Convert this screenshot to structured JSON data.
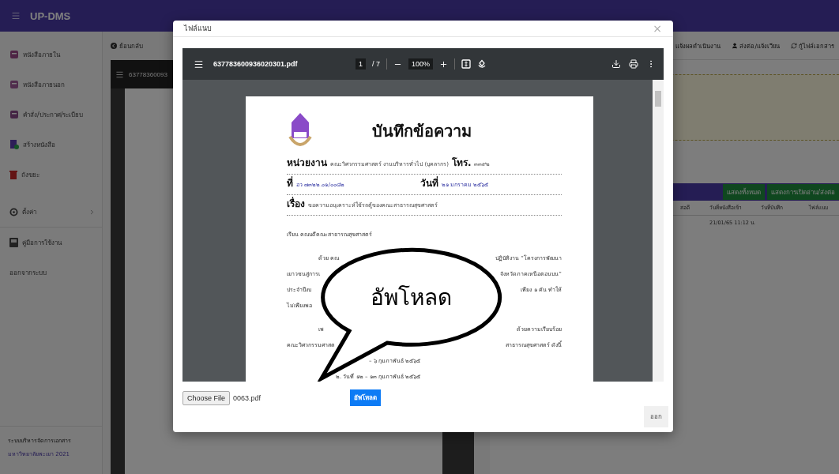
{
  "app": {
    "title": "UP-DMS"
  },
  "sidebar": {
    "items": [
      {
        "label": "หนังสือภายใน"
      },
      {
        "label": "หนังสือภายนอก"
      },
      {
        "label": "คำสั่ง/ประกาศ/ระเบียบ"
      },
      {
        "label": "สร้างหนังสือ"
      },
      {
        "label": "ถังขยะ"
      },
      {
        "label": "ตั้งค่า",
        "expanded": false
      },
      {
        "label": "คู่มือการใช้งาน"
      },
      {
        "label": "ออกจากระบบ"
      }
    ],
    "footer": {
      "line_1": "ระบบบริหารจัดการเอกสาร",
      "line_2": "มหาวิทยาลัยพะเยา 2021"
    }
  },
  "main": {
    "back_link": "ย้อนกลับ",
    "viewer_filename": "63778360093",
    "actions": [
      "แจ้งผลดำเนินงาน",
      "ส่งต่อ/แจ้งเวียน",
      "กู้ไฟล์เอกสาร"
    ],
    "table": {
      "buttons": [
        "แสดงทั้งหมด",
        "แสดงการเปิดอ่าน/ส่งต่อ"
      ],
      "columns": [
        "สอดี",
        "วันที่หนังสือเข้า",
        "วันที่บันทึก",
        "ไฟล์แนบ"
      ],
      "rows": [
        {
          "date_in": "21/01/65 11:12 น."
        }
      ]
    }
  },
  "modal": {
    "title": "ไฟล์แนบ",
    "close": "×",
    "viewer": {
      "filename": "637783600936020301.pdf",
      "page": "1",
      "page_count": "/ 7",
      "zoom": "100%"
    },
    "document": {
      "title": "บันทึกข้อความ",
      "fields": [
        [
          {
            "kind": "label",
            "text": "หน่วยงาน"
          },
          {
            "kind": "value",
            "text": "คณะวิศวกรรมศาสตร์  งานบริหารทั่วไป (บุคลากร)"
          },
          {
            "kind": "label",
            "text": "โทร."
          },
          {
            "kind": "value",
            "text": "๓๓๙๒"
          }
        ],
        [
          {
            "kind": "label",
            "text": "ที่"
          },
          {
            "kind": "filled",
            "text": "อว ๗๓๒๒.๐๑/๐๐๘๒"
          },
          {
            "kind": "label",
            "text": "วันที่"
          },
          {
            "kind": "filled",
            "text": "๒๑ มกราคม ๒๕๖๕"
          }
        ],
        [
          {
            "kind": "label",
            "text": "เรื่อง"
          },
          {
            "kind": "value",
            "text": "ขอความอนุเคราะห์ใช้รถตู้ของคณะสาธารณสุขศาสตร์"
          }
        ]
      ],
      "lines": [
        {
          "kind": "plain",
          "left": "เรียน  คณบดีคณะสาธารณสุขศาสตร์"
        },
        {
          "kind": "indent",
          "left": "ด้วย คณ",
          "right": "ปฏิบัติงาน “โครงการพัฒนา"
        },
        {
          "kind": "plain",
          "left": "เยาวชนสู่การเ",
          "right": "จังหวัดภาคเหนือตอนบน”"
        },
        {
          "kind": "plain",
          "left": "ประจำปีงบ",
          "right": "เพียง ๑ คัน ทำให้"
        },
        {
          "kind": "plain",
          "left": "ไม่เพียงพอ"
        },
        {
          "kind": "indent",
          "left": "เพ",
          "right": "ด้วยความเรียบร้อย"
        },
        {
          "kind": "plain",
          "left": "คณะวิศวกรรมศาสต",
          "right": "สาธารณสุขศาสตร์ ดังนี้"
        },
        {
          "kind": "partial",
          "left": "– ๖ กุมภาพันธ์ ๒๕๖๕"
        },
        {
          "kind": "list",
          "left": "๒. วันที่ ๑๒ – ๑๓ กุมภาพันธ์ ๒๕๖๕"
        }
      ]
    },
    "file_input": {
      "button": "Choose File",
      "file_name": "0063.pdf"
    },
    "upload_button": "อัพโหลด",
    "exit_button": "ออก"
  },
  "callout": {
    "text": "อัพโหลด"
  }
}
